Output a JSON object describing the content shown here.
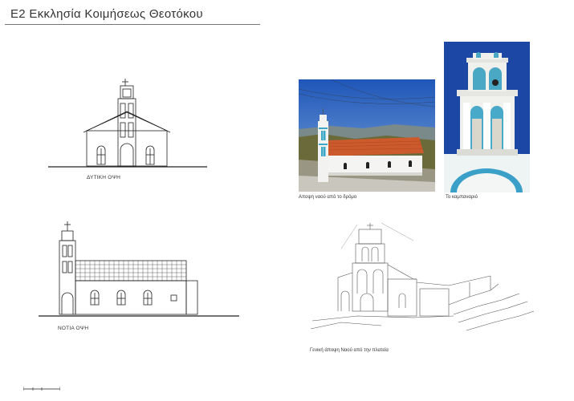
{
  "header": {
    "title": "Ε2  Εκκλησία Κοιμήσεως Θεοτόκου"
  },
  "drawings": {
    "west_elevation_label": "ΔΥΤΙΚΗ ΟΨΗ",
    "south_elevation_label": "ΝΟΤΙΑ ΟΨΗ"
  },
  "photos": {
    "road_view_caption": "Αποψη ναού από το δρόμο",
    "bell_tower_caption": "Το καμπαναριό"
  },
  "sketch": {
    "caption": "Γενική άποψη Ναού από την πλατεία"
  }
}
